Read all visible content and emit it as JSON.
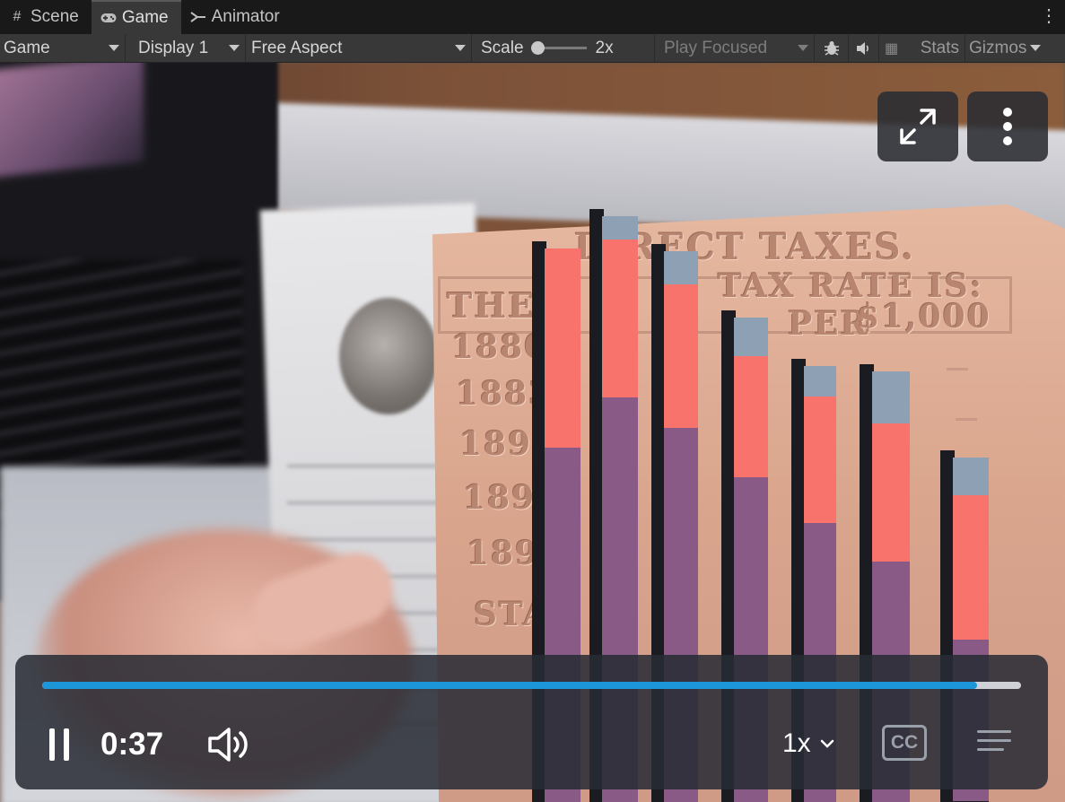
{
  "tabs": [
    {
      "label": "Scene",
      "icon": "hash-icon"
    },
    {
      "label": "Game",
      "icon": "gamepad-icon",
      "active": true
    },
    {
      "label": "Animator",
      "icon": "animator-icon"
    }
  ],
  "toolbar": {
    "view_dropdown": "Game",
    "display_dropdown": "Display 1",
    "aspect_dropdown": "Free Aspect",
    "scale_label": "Scale",
    "scale_value": "2x",
    "play_mode_dropdown": "Play Focused",
    "stats_label": "Stats",
    "gizmos_label": "Gizmos"
  },
  "overlay_text": {
    "header": "DIRECT TAXES.",
    "line1": "THE",
    "line1b": "TAX RATE IS:",
    "line2": "PER",
    "line2b": "$1,000",
    "years": [
      "1880",
      "1883",
      "1890",
      "1895",
      "1899"
    ],
    "footer": "STA"
  },
  "bars_3d": [
    {
      "top_fraction": 0.0,
      "red_fraction": 0.36,
      "purple_fraction": 0.64
    },
    {
      "top_fraction": 0.04,
      "red_fraction": 0.27,
      "purple_fraction": 0.69
    },
    {
      "top_fraction": 0.06,
      "red_fraction": 0.26,
      "purple_fraction": 0.68
    },
    {
      "top_fraction": 0.08,
      "red_fraction": 0.25,
      "purple_fraction": 0.67
    },
    {
      "top_fraction": 0.07,
      "red_fraction": 0.29,
      "purple_fraction": 0.64
    },
    {
      "top_fraction": 0.12,
      "red_fraction": 0.32,
      "purple_fraction": 0.56
    },
    {
      "top_fraction": 0.11,
      "red_fraction": 0.42,
      "purple_fraction": 0.47
    }
  ],
  "colors": {
    "bar_red": "#f8736b",
    "bar_purple": "#8a5a86",
    "bar_cap": "#8ea1b4",
    "progress": "#1d95d9",
    "editor_bg": "#383838"
  },
  "player": {
    "time": "0:37",
    "speed": "1x",
    "cc_label": "CC",
    "progress_fraction": 0.955
  }
}
